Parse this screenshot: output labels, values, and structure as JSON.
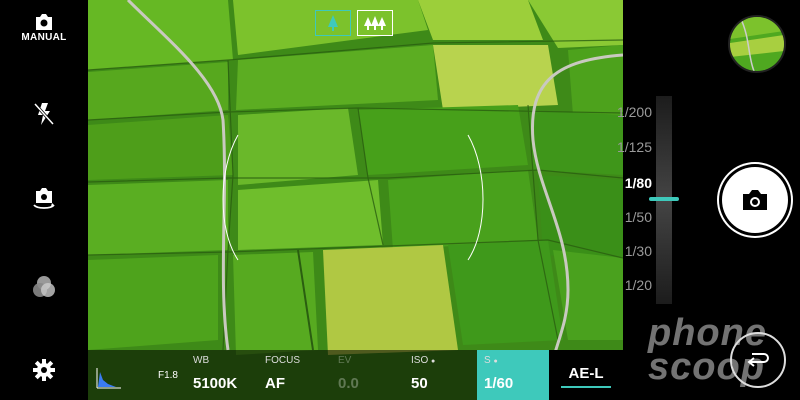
{
  "left_bar": {
    "mode_label": "MANUAL",
    "icons": [
      "camera-mode-icon",
      "flash-off-icon",
      "switch-camera-icon",
      "filter-icon",
      "settings-icon"
    ]
  },
  "mode_buttons": [
    {
      "name": "single-tree-focus",
      "active": true
    },
    {
      "name": "multi-tree-focus",
      "active": false
    }
  ],
  "shutter_scale": {
    "ticks": [
      "1/200",
      "1/125",
      "1/80",
      "1/50",
      "1/30",
      "1/20"
    ],
    "current": "1/80"
  },
  "bottom_bar": {
    "aperture": "F1.8",
    "wb_label": "WB",
    "wb_value": "5100K",
    "focus_label": "FOCUS",
    "focus_value": "AF",
    "ev_label": "EV",
    "ev_value": "0.0",
    "iso_label": "ISO",
    "iso_value": "50",
    "shutter_label": "S",
    "shutter_value": "1/60",
    "lock_label": "AE-L"
  },
  "watermark": {
    "line1": "phone",
    "line2": "scoop"
  },
  "colors": {
    "accent": "#3ec9bb",
    "field_green": "#3e8a18"
  }
}
